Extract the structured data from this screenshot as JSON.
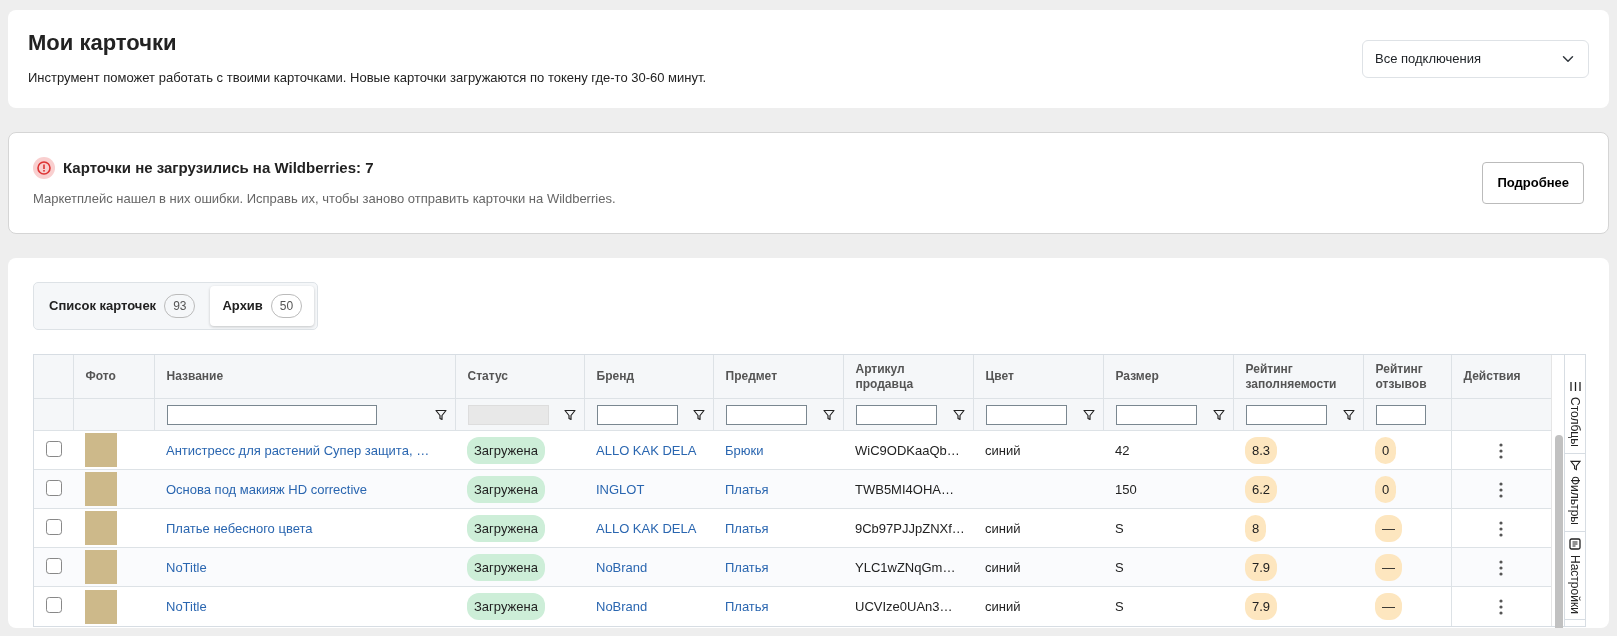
{
  "header": {
    "title": "Мои карточки",
    "description": "Инструмент поможет работать с твоими карточками. Новые карточки загружаются по токену где-то 30-60 минут.",
    "connection_select": {
      "value": "Все подключения"
    }
  },
  "alert": {
    "title": "Карточки не загрузились на Wildberries: 7",
    "text": "Маркетплейс нашел в них ошибки. Исправь их, чтобы заново отправить карточки на Wildberries.",
    "button": "Подробнее"
  },
  "tabs": [
    {
      "label": "Список карточек",
      "count": "93",
      "selected": false
    },
    {
      "label": "Архив",
      "count": "50",
      "selected": true
    }
  ],
  "table": {
    "columns": [
      {
        "label": "Фото",
        "kind": "photo",
        "filter": false,
        "filter_disabled": false
      },
      {
        "label": "Название",
        "kind": "link",
        "filter": true,
        "filter_disabled": false
      },
      {
        "label": "Статус",
        "kind": "status",
        "filter": true,
        "filter_disabled": true
      },
      {
        "label": "Бренд",
        "kind": "link",
        "filter": true,
        "filter_disabled": false
      },
      {
        "label": "Предмет",
        "kind": "link",
        "filter": true,
        "filter_disabled": false
      },
      {
        "label": "Артикул продавца",
        "kind": "text",
        "filter": true,
        "filter_disabled": false
      },
      {
        "label": "Цвет",
        "kind": "text",
        "filter": true,
        "filter_disabled": false
      },
      {
        "label": "Размер",
        "kind": "text",
        "filter": true,
        "filter_disabled": false
      },
      {
        "label": "Рейтинг заполняемости",
        "kind": "rating",
        "filter": true,
        "filter_disabled": false
      },
      {
        "label": "Рейтинг отзывов",
        "kind": "rating",
        "filter": true,
        "filter_disabled": false
      },
      {
        "label": "Действия",
        "kind": "actions",
        "filter": false,
        "filter_disabled": false
      }
    ],
    "rows": [
      {
        "checked": false,
        "cells": [
          "",
          "Антистресс для растений Супер защита, …",
          "Загружена",
          "ALLO KAK DELA",
          "Брюки",
          "WiC9ODKaaQb…",
          "синий",
          "42",
          "8.3",
          "0",
          ""
        ]
      },
      {
        "checked": false,
        "cells": [
          "",
          "Основа под макияж HD corrective",
          "Загружена",
          "INGLOT",
          "Платья",
          "TWB5MI4OHA…",
          "",
          "150",
          "6.2",
          "0",
          ""
        ]
      },
      {
        "checked": false,
        "cells": [
          "",
          "Платье небесного цвета",
          "Загружена",
          "ALLO KAK DELA",
          "Платья",
          "9Cb97PJJpZNXf…",
          "синий",
          "S",
          "8",
          "—",
          ""
        ]
      },
      {
        "checked": false,
        "cells": [
          "",
          "NoTitle",
          "Загружена",
          "NoBrand",
          "Платья",
          "YLC1wZNqGm…",
          "синий",
          "S",
          "7.9",
          "—",
          ""
        ]
      },
      {
        "checked": false,
        "cells": [
          "",
          "NoTitle",
          "Загружена",
          "NoBrand",
          "Платья",
          "UCVIze0UAn3…",
          "синий",
          "S",
          "7.9",
          "—",
          ""
        ]
      }
    ]
  },
  "side_panel": [
    {
      "label": "Столбцы",
      "kind": "columns"
    },
    {
      "label": "Фильтры",
      "kind": "filters"
    },
    {
      "label": "Настройки",
      "kind": "settings"
    }
  ]
}
